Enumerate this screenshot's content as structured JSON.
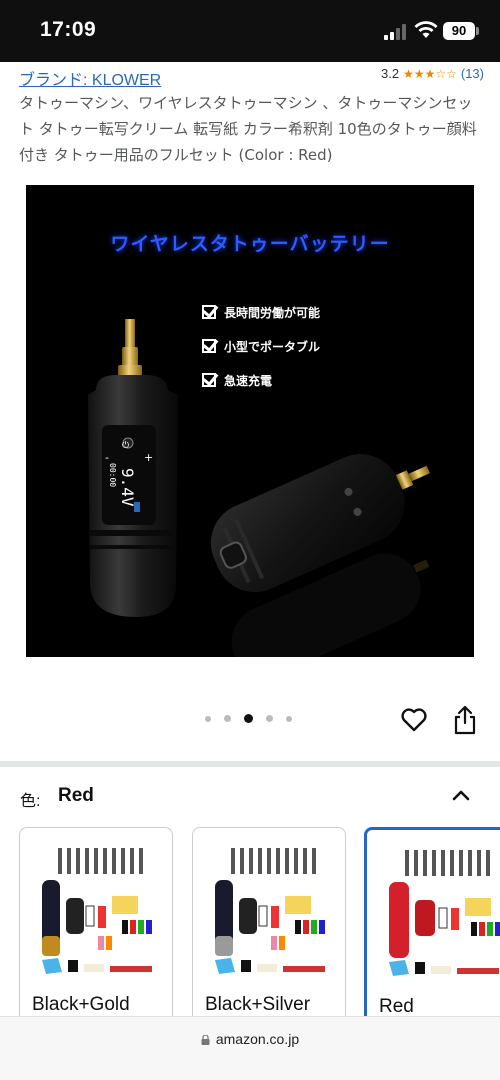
{
  "status_bar": {
    "time": "17:09",
    "battery": "90"
  },
  "product": {
    "brand": "ブランド: KLOWER",
    "rating": "3.2",
    "rating_stars": 3.2,
    "review_count": "(13)",
    "title": "タトゥーマシン、ワイヤレスタトゥーマシン 、タトゥーマシンセット タトゥー転写クリーム 転写紙 カラー希釈剤 10色のタトゥー顔料付き タトゥー用品のフルセット (Color : Red)"
  },
  "hero_image": {
    "heading": "ワイヤレスタトゥーバッテリー",
    "features": [
      "長時間労働が可能",
      "小型でポータブル",
      "急速充電"
    ],
    "device_readout": "9.4V",
    "device_time": "00:00"
  },
  "gallery": {
    "dot_count": 5,
    "active_index": 2
  },
  "color_selector": {
    "label": "色:",
    "selected": "Red",
    "options": [
      "Black+Gold",
      "Black+Silver",
      "Red"
    ]
  },
  "browser": {
    "url": "amazon.co.jp"
  },
  "colors": {
    "link": "#2a6ab5",
    "star": "#e88a00",
    "selected_border": "#2568c3",
    "hero_heading": "#2d5cff"
  }
}
